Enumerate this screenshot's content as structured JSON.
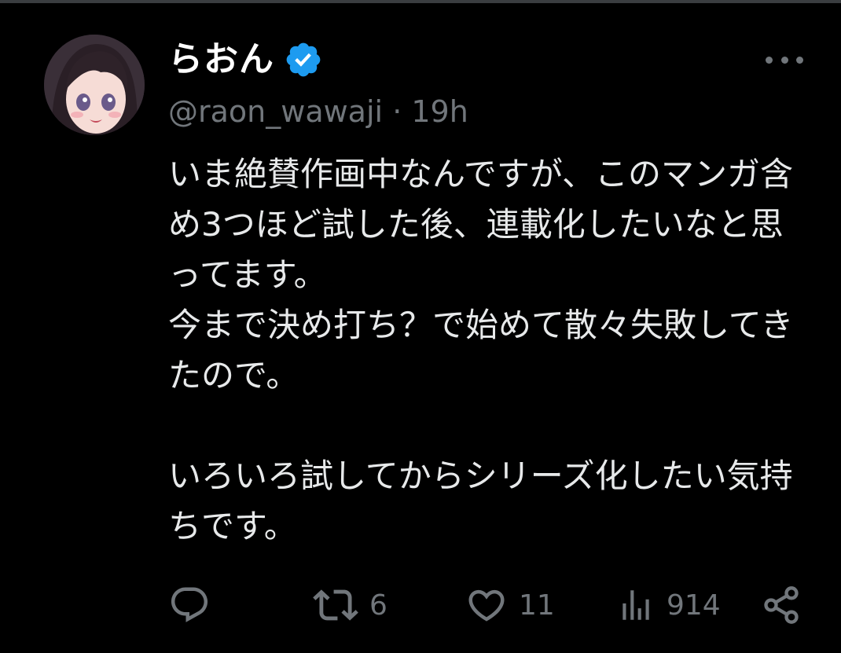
{
  "tweet": {
    "display_name": "らおん",
    "handle": "@raon_wawaji",
    "separator": "·",
    "time": "19h",
    "paragraphs": [
      "いま絶賛作画中なんですが、このマンガ含め3つほど試した後、連載化したいなと思ってます。\n今まで決め打ち？で始めて散々失敗してきたので。",
      "いろいろ試してからシリーズ化したい気持ちです。"
    ]
  },
  "metrics": {
    "replies": "",
    "reposts": "6",
    "likes": "11",
    "views": "914"
  },
  "icons": {
    "verified": "verified-badge-icon",
    "more": "more-options-icon",
    "reply": "reply-icon",
    "repost": "repost-icon",
    "like": "heart-icon",
    "views": "analytics-icon",
    "share": "share-icon"
  },
  "colors": {
    "background": "#000000",
    "text": "#e7e9ea",
    "secondary_text": "#71767b",
    "verified_blue": "#1d9bf0"
  }
}
